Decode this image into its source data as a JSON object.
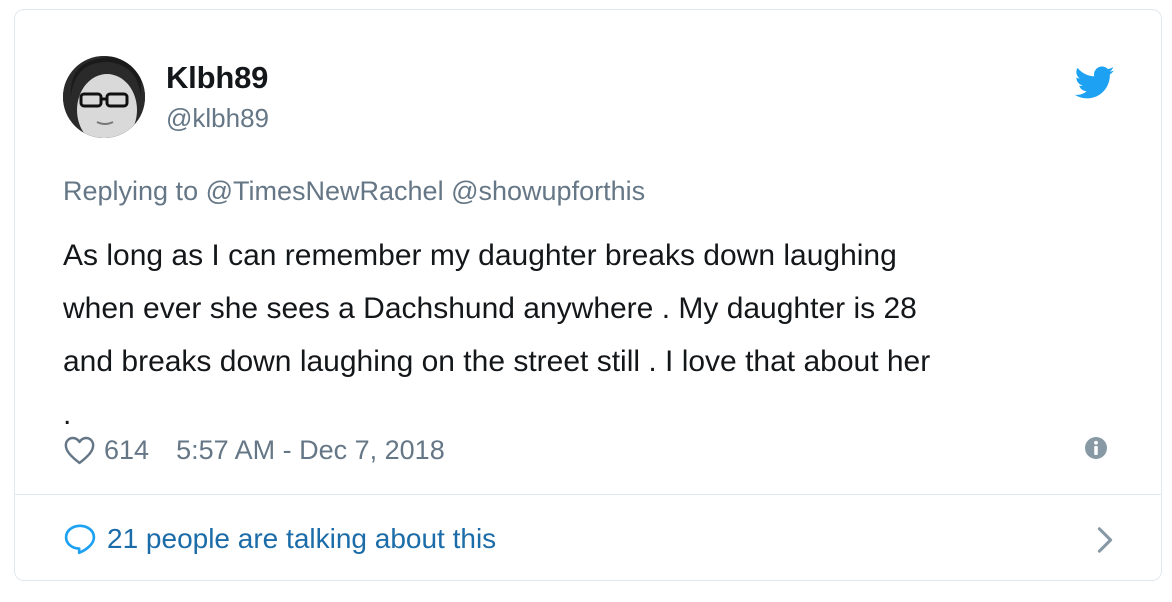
{
  "author": {
    "display_name": "Klbh89",
    "handle": "@klbh89"
  },
  "reply": {
    "prefix": "Replying to",
    "mentions": [
      "@TimesNewRachel",
      "@showupforthis"
    ]
  },
  "tweet": {
    "text": "As long as I can remember my daughter breaks down laughing\nwhen ever she sees a Dachshund anywhere . My daughter is 28\nand breaks down laughing on the street still . I love that about her\n."
  },
  "meta": {
    "likes": "614",
    "timestamp": "5:57 AM - Dec 7, 2018"
  },
  "footer": {
    "talking": "21 people are talking about this"
  },
  "colors": {
    "twitter_blue": "#1da1f2",
    "muted": "#657786",
    "link": "#1b6ca8",
    "text": "#14171a"
  },
  "icons": {
    "brand": "twitter-bird-icon",
    "like": "heart-icon",
    "info": "info-icon",
    "conversation": "speech-bubble-icon",
    "navigate": "chevron-right-icon"
  }
}
